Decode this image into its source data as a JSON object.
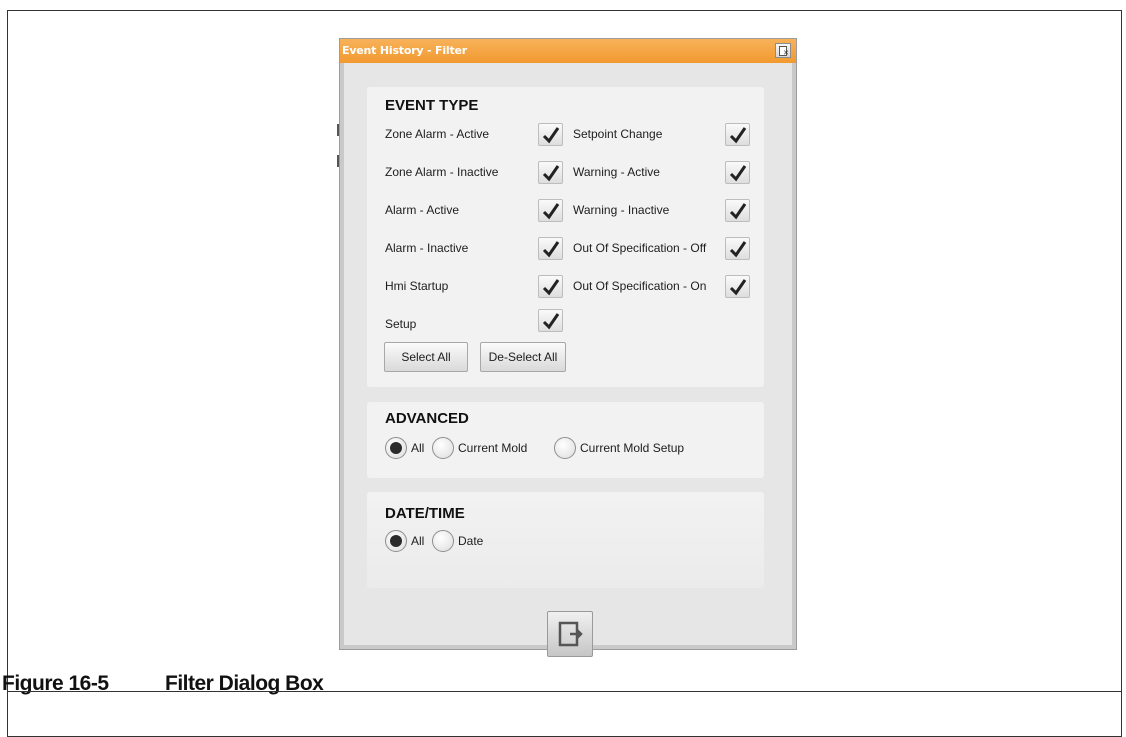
{
  "window": {
    "title": "Event History - Filter"
  },
  "icons": {
    "close": "window-close-icon",
    "checkmark": "checkmark-icon",
    "exit": "exit-door-icon"
  },
  "colors": {
    "titlebar": "#f19a2f",
    "panel": "#f2f2f2",
    "background": "#e6e6e6"
  },
  "event_type": {
    "heading": "EVENT TYPE",
    "left_items": [
      {
        "label": "Zone Alarm - Active",
        "checked": true
      },
      {
        "label": "Zone Alarm - Inactive",
        "checked": true
      },
      {
        "label": "Alarm - Active",
        "checked": true
      },
      {
        "label": "Alarm - Inactive",
        "checked": true
      },
      {
        "label": "Hmi Startup",
        "checked": true
      },
      {
        "label": "Setup",
        "checked": true
      }
    ],
    "right_items": [
      {
        "label": "Setpoint Change",
        "checked": true
      },
      {
        "label": "Warning - Active",
        "checked": true
      },
      {
        "label": "Warning - Inactive",
        "checked": true
      },
      {
        "label": "Out Of Specification - Off",
        "checked": true
      },
      {
        "label": "Out Of Specification - On",
        "checked": true
      }
    ],
    "select_all_label": "Select All",
    "deselect_all_label": "De-Select All"
  },
  "advanced": {
    "heading": "ADVANCED",
    "options": [
      {
        "label": "All",
        "selected": true
      },
      {
        "label": "Current Mold",
        "selected": false
      },
      {
        "label": "Current Mold Setup",
        "selected": false
      }
    ]
  },
  "date_time": {
    "heading": "DATE/TIME",
    "options": [
      {
        "label": "All",
        "selected": true
      },
      {
        "label": "Date",
        "selected": false
      }
    ]
  },
  "caption": {
    "number": "Figure 16-5",
    "title": "Filter Dialog Box"
  }
}
